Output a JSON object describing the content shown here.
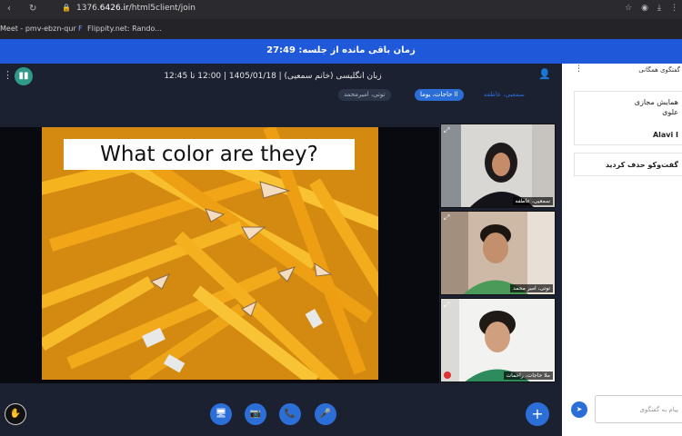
{
  "browser": {
    "url_prefix": "1376.",
    "url_host": "6426.ir",
    "url_path": "/html5client/join",
    "bookmarks": [
      "Meet - pmv-ebzn-qur",
      "Flippity.net: Rando..."
    ]
  },
  "topbar": {
    "timer_text": "زمان باقی مانده از جلسه: 27:49"
  },
  "header": {
    "meeting_title": "زبان انگلیسی (خانم سمعیی) | 1405/01/18 | 12:00 تا 12:45",
    "logo_text": "▮▮",
    "chips": [
      {
        "label": "سمعیی، عاطفه"
      },
      {
        "label": "اا حاجات، یوما"
      },
      {
        "label": "توتی، امیرمحمد"
      }
    ]
  },
  "slide": {
    "title": "What color are they?"
  },
  "tiles": [
    {
      "name": "سمعیی، عاطفه"
    },
    {
      "name": "توتی، امیر محمد"
    },
    {
      "name": "ملا حاجات، راحمات"
    }
  ],
  "chat": {
    "title": "گفتگوی همگانی",
    "messages": [
      {
        "lines": [
          "همایش مجازی",
          "علوی",
          "Alavi I"
        ]
      },
      {
        "lines": [
          "گفت‌وکو حذف کردید"
        ]
      }
    ],
    "input_placeholder": "پیام به گفتگوی"
  },
  "icons": {
    "back": "‹",
    "refresh": "↻",
    "lock": "🔒",
    "hand": "✋",
    "screen": "🖥",
    "camera": "📷",
    "phone": "📞",
    "mic": "🎤",
    "plus": "+",
    "send": "➤",
    "users": "👤",
    "dots": "⋮",
    "expand": "⤢"
  }
}
